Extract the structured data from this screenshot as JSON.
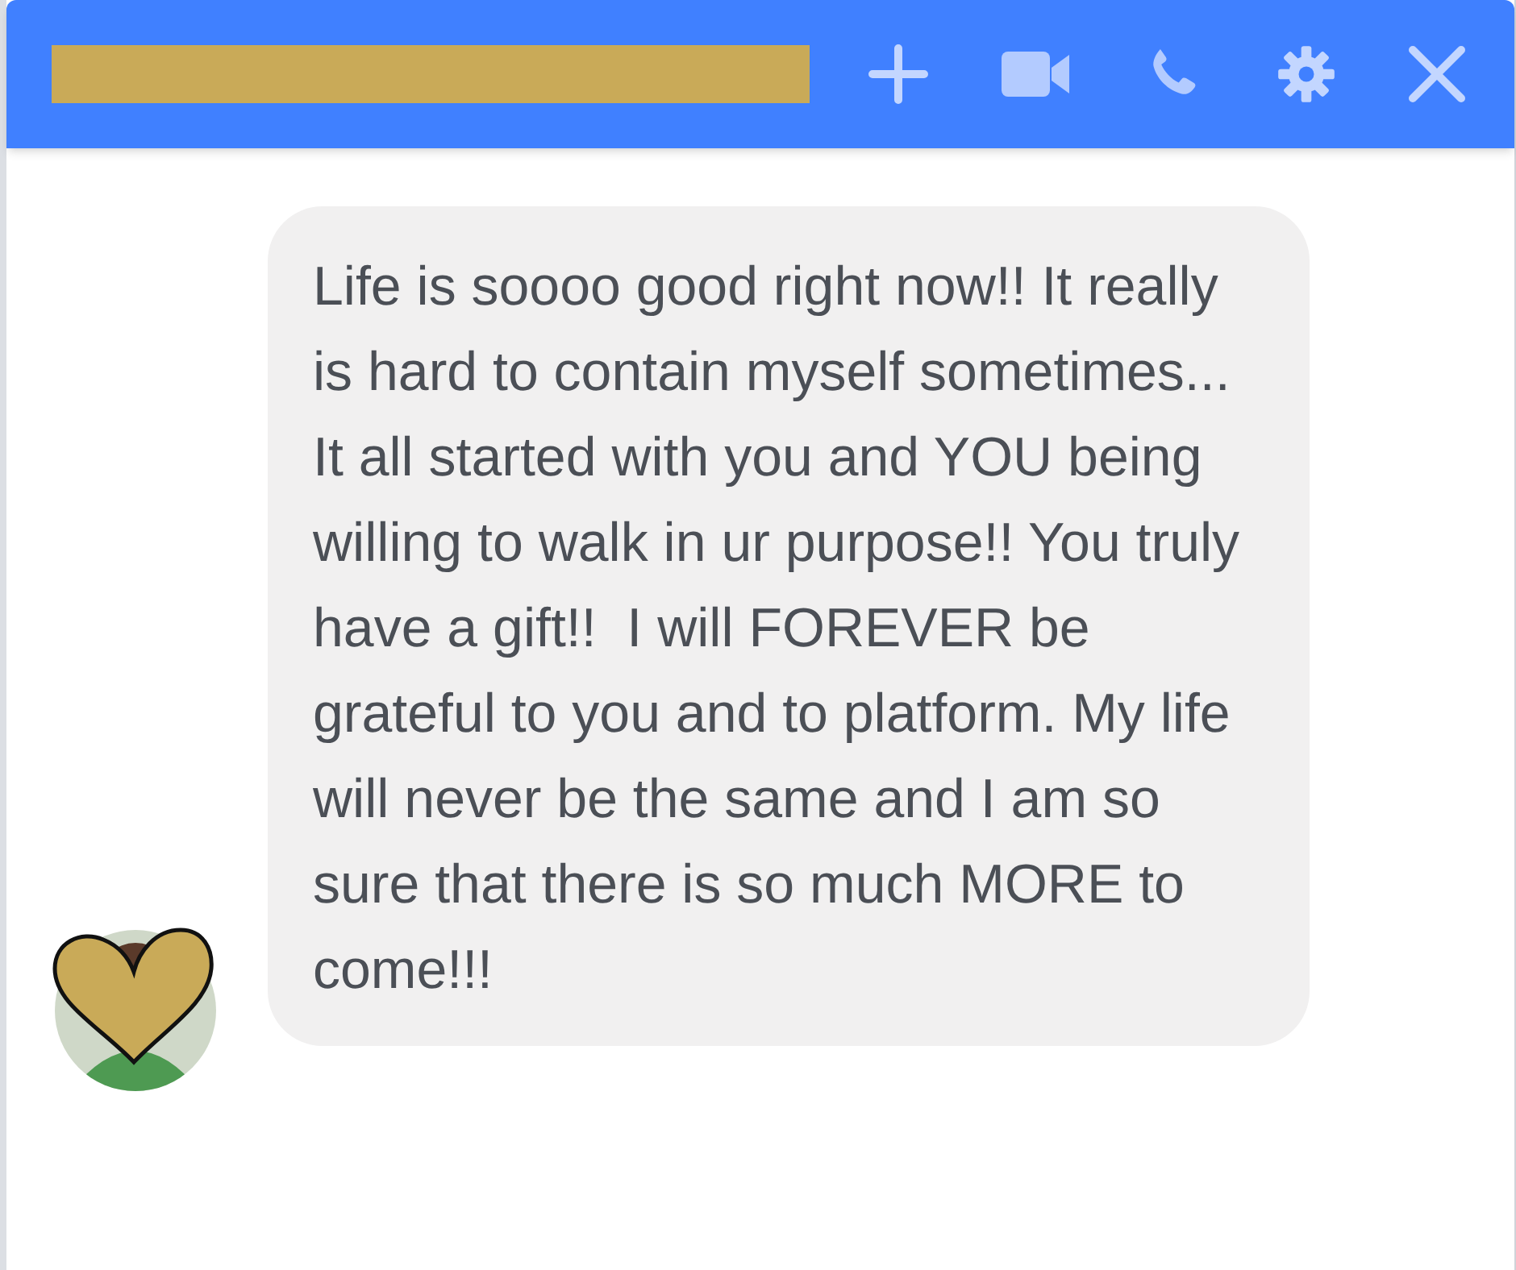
{
  "chat_header": {
    "name_redacted": true
  },
  "messages": [
    {
      "text": "Life is soooo good right now!! It really is hard to contain myself sometimes... It all started with you and YOU being willing to walk in ur purpose!! You truly have a gift!!  I will FOREVER be grateful to you and to platform. My life will never be the same and I am so sure that there is so much MORE to come!!!",
      "avatar_covered": true
    }
  ]
}
